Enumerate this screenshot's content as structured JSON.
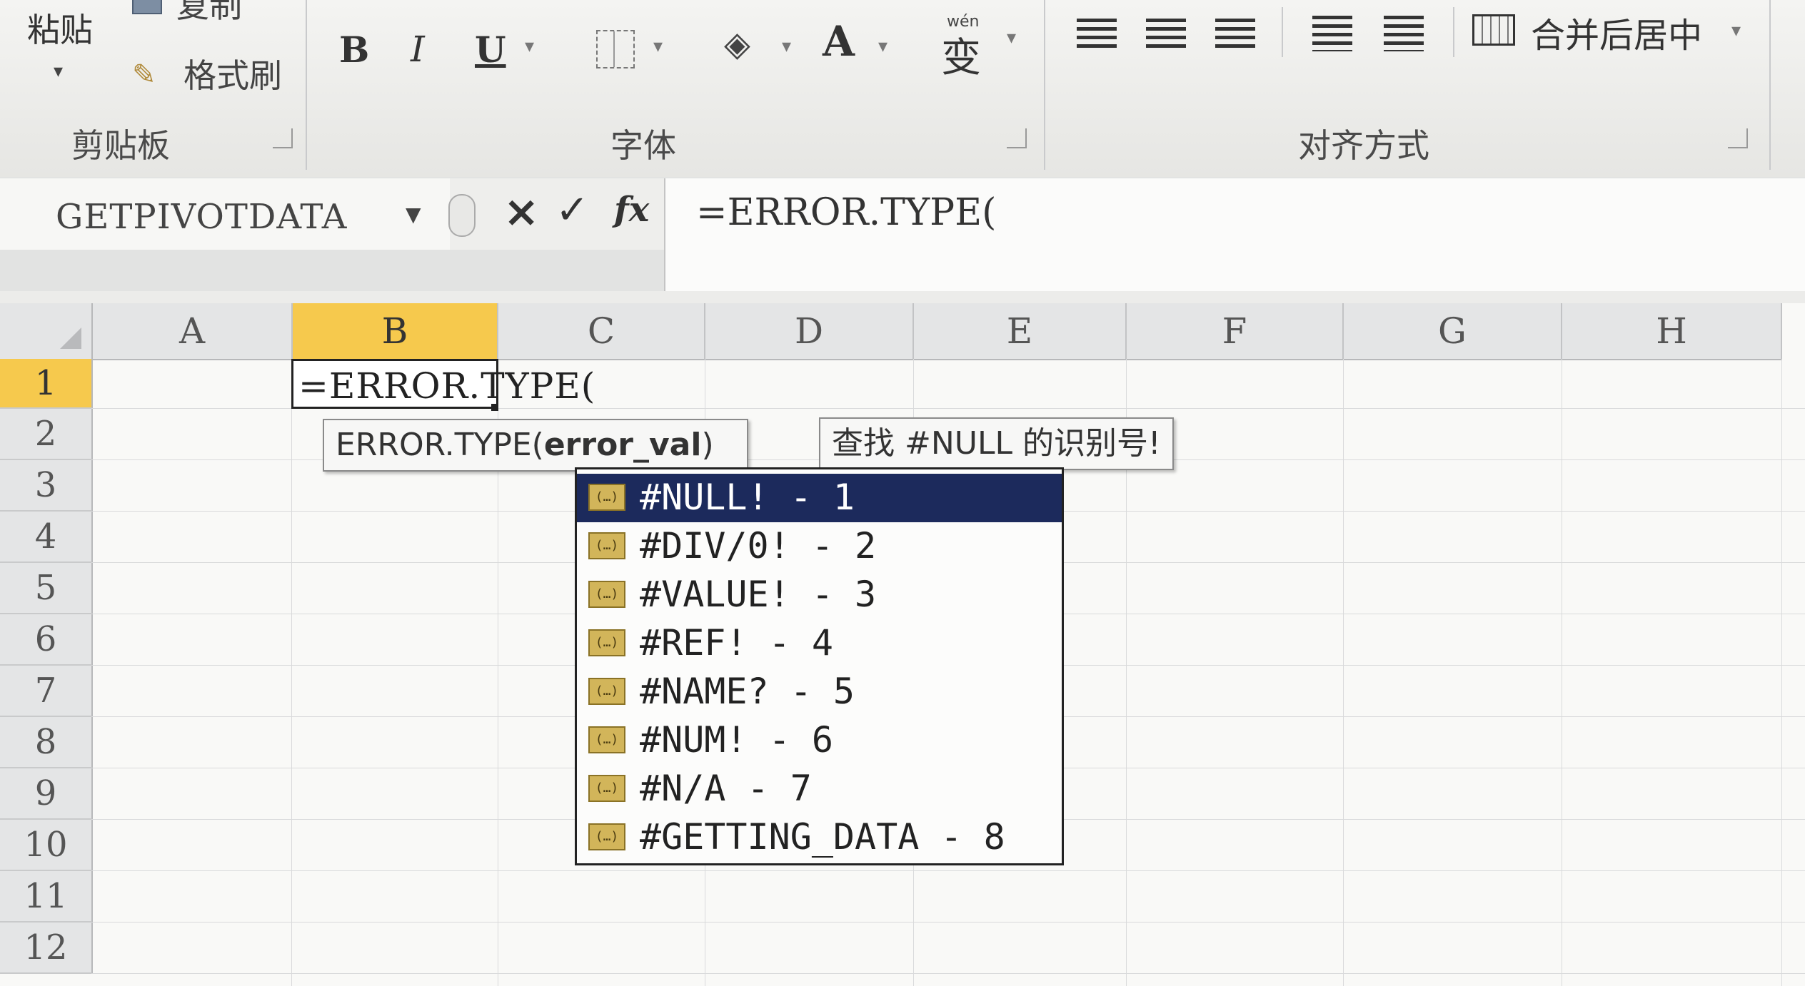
{
  "ribbon": {
    "clipboard": {
      "paste_label": "粘贴",
      "copy_label": "复制",
      "format_painter_label": "格式刷",
      "group_label": "剪贴板"
    },
    "font": {
      "bold_label": "B",
      "italic_label": "I",
      "underline_label": "U",
      "font_color_label": "A",
      "phonetic_label": "wén",
      "phonetic_char": "变",
      "group_label": "字体"
    },
    "alignment": {
      "merge_center_label": "合并后居中",
      "group_label": "对齐方式"
    }
  },
  "formula_bar": {
    "name_box_value": "GETPIVOTDATA",
    "cancel_icon": "×",
    "enter_icon": "✓",
    "fx_label": "fx",
    "formula_value": "=ERROR.TYPE("
  },
  "grid": {
    "columns": [
      "A",
      "B",
      "C",
      "D",
      "E",
      "F",
      "G",
      "H"
    ],
    "rows": [
      "1",
      "2",
      "3",
      "4",
      "5",
      "6",
      "7",
      "8",
      "9",
      "10",
      "11",
      "12"
    ],
    "selected_column": "B",
    "selected_row": "1",
    "active_cell_value": "=ERROR.TYPE("
  },
  "tooltips": {
    "syntax_func": "ERROR.TYPE(",
    "syntax_arg": "error_val",
    "syntax_close": ")",
    "description": "查找 #NULL 的识别号!"
  },
  "autocomplete": {
    "items": [
      {
        "label": "#NULL! - 1"
      },
      {
        "label": "#DIV/0! - 2"
      },
      {
        "label": "#VALUE! - 3"
      },
      {
        "label": "#REF! - 4"
      },
      {
        "label": "#NAME? - 5"
      },
      {
        "label": "#NUM! - 6"
      },
      {
        "label": "#N/A - 7"
      },
      {
        "label": "#GETTING_DATA - 8"
      }
    ],
    "icon_glyph": "(…)",
    "selected_index": 0
  }
}
